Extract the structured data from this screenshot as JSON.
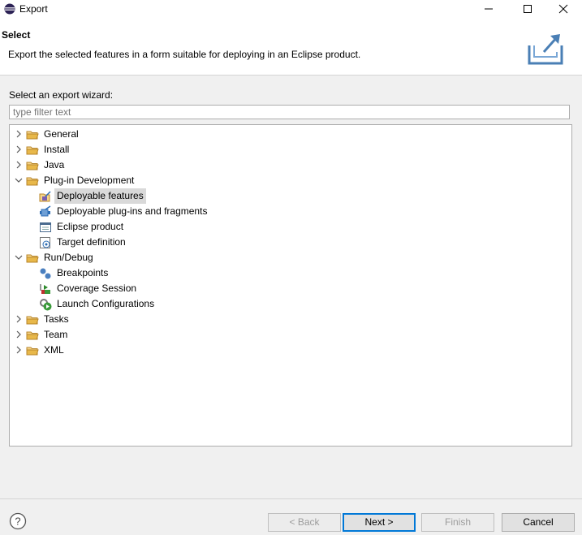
{
  "window": {
    "title": "Export"
  },
  "header": {
    "title": "Select",
    "description": "Export the selected features in a form suitable for deploying in an Eclipse product."
  },
  "wizard_label": "Select an export wizard:",
  "filter": {
    "placeholder": "type filter text",
    "value": ""
  },
  "tree": {
    "nodes": [
      {
        "label": "General",
        "expanded": false
      },
      {
        "label": "Install",
        "expanded": false
      },
      {
        "label": "Java",
        "expanded": false
      },
      {
        "label": "Plug-in Development",
        "expanded": true,
        "children": [
          {
            "label": "Deployable features",
            "icon": "feature-export-icon",
            "selected": true
          },
          {
            "label": "Deployable plug-ins and fragments",
            "icon": "plugin-export-icon"
          },
          {
            "label": "Eclipse product",
            "icon": "product-icon"
          },
          {
            "label": "Target definition",
            "icon": "target-icon"
          }
        ]
      },
      {
        "label": "Run/Debug",
        "expanded": true,
        "children": [
          {
            "label": "Breakpoints",
            "icon": "breakpoints-icon"
          },
          {
            "label": "Coverage Session",
            "icon": "coverage-icon"
          },
          {
            "label": "Launch Configurations",
            "icon": "launch-config-icon"
          }
        ]
      },
      {
        "label": "Tasks",
        "expanded": false
      },
      {
        "label": "Team",
        "expanded": false
      },
      {
        "label": "XML",
        "expanded": false
      }
    ]
  },
  "buttons": {
    "back": "< Back",
    "next": "Next >",
    "finish": "Finish",
    "cancel": "Cancel"
  },
  "colors": {
    "selection": "#d9d9d9",
    "primary_border": "#0078d7",
    "folder": "#e8b84a"
  }
}
